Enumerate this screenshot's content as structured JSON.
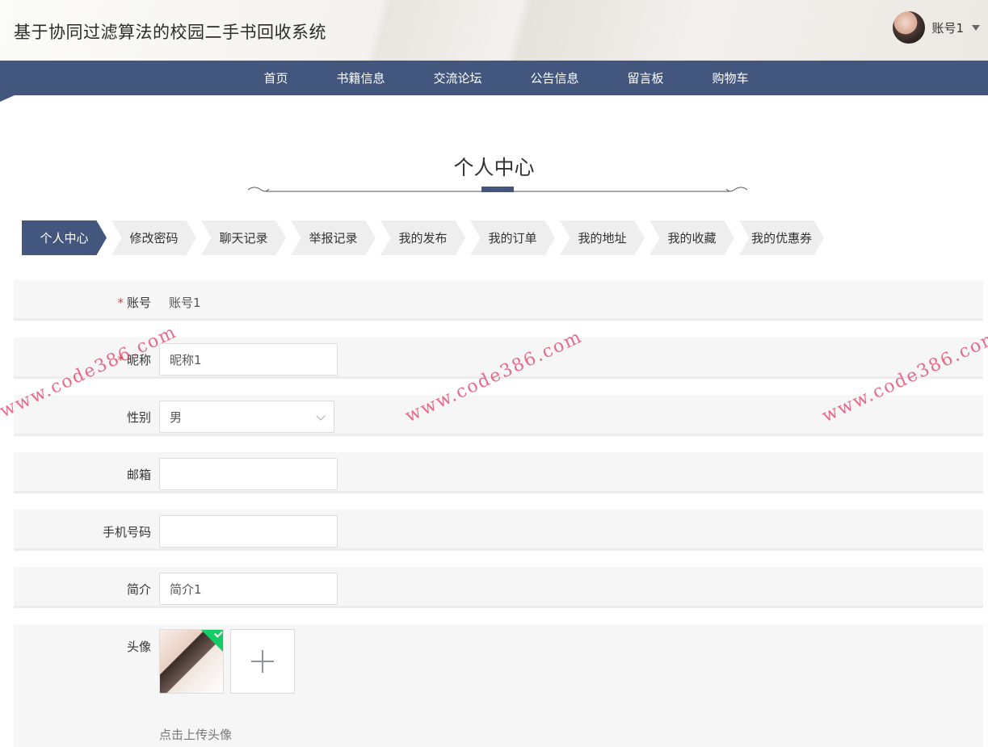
{
  "header": {
    "title": "基于协同过滤算法的校园二手书回收系统",
    "user_name": "账号1"
  },
  "nav": {
    "items": [
      "首页",
      "书籍信息",
      "交流论坛",
      "公告信息",
      "留言板",
      "购物车"
    ]
  },
  "page": {
    "title": "个人中心"
  },
  "tabs": [
    "个人中心",
    "修改密码",
    "聊天记录",
    "举报记录",
    "我的发布",
    "我的订单",
    "我的地址",
    "我的收藏",
    "我的优惠券"
  ],
  "active_tab": 0,
  "form": {
    "account": {
      "label": "账号",
      "required": "*",
      "value": "账号1"
    },
    "nickname": {
      "label": "昵称",
      "required": "*",
      "value": "昵称1"
    },
    "gender": {
      "label": "性别",
      "value": "男"
    },
    "email": {
      "label": "邮箱",
      "value": ""
    },
    "phone": {
      "label": "手机号码",
      "value": ""
    },
    "bio": {
      "label": "简介",
      "value": "简介1"
    },
    "avatar": {
      "label": "头像",
      "hint": "点击上传头像"
    }
  },
  "watermark": "www.code386.com",
  "colors": {
    "primary": "#43567e",
    "required": "#e0413a",
    "success": "#13ce66"
  }
}
